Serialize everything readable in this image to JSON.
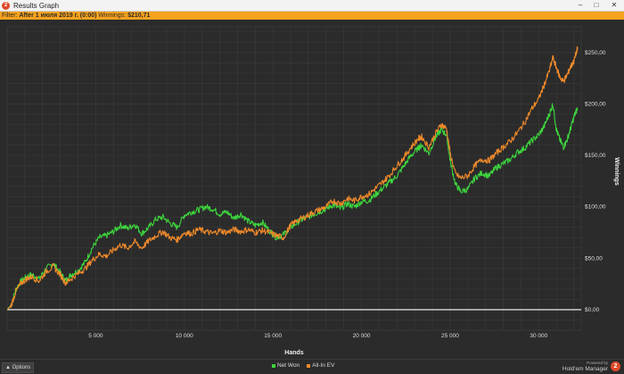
{
  "window": {
    "title": "Results Graph",
    "app_icon_label": "2",
    "minimize": "–",
    "maximize": "□",
    "close": "✕"
  },
  "filter": {
    "label": "Filter:",
    "value": "After 1 июля 2019 г. (0:00)",
    "winnings_label": "Winnings:",
    "winnings_value": "$210,71"
  },
  "footer": {
    "options_label": "Options",
    "options_icon": "triangle-up-icon",
    "brand_small": "Powered by",
    "brand": "Hold'em Manager",
    "brand_logo": "2"
  },
  "colors": {
    "net_won": "#3dd63d",
    "all_in_ev": "#f08a2a",
    "background": "#2b2b2b",
    "grid": "#3b3b3b",
    "zero_line": "#ffffff",
    "filter_bar": "#f6a21e"
  },
  "chart_data": {
    "type": "line",
    "xlabel": "Hands",
    "ylabel": "Winnings",
    "xlim": [
      0,
      32400
    ],
    "ylim": [
      -20,
      275
    ],
    "x_ticks": [
      5000,
      10000,
      15000,
      20000,
      25000,
      30000
    ],
    "x_tick_labels": [
      "5 000",
      "10 000",
      "15 000",
      "20 000",
      "25 000",
      "30 000"
    ],
    "y_ticks": [
      0,
      50,
      100,
      150,
      200,
      250
    ],
    "y_tick_labels": [
      "$0,00",
      "$50,00",
      "$100,00",
      "$150,00",
      "$200,00",
      "$250,00"
    ],
    "legend_position": "bottom-center",
    "grid": true,
    "series": [
      {
        "name": "Net Won",
        "color": "#3dd63d",
        "x": [
          0,
          200,
          500,
          800,
          1100,
          1400,
          1800,
          2200,
          2600,
          3000,
          3300,
          3600,
          4000,
          4400,
          4800,
          5200,
          5600,
          6000,
          6400,
          6800,
          7200,
          7600,
          8000,
          8400,
          8800,
          9200,
          9600,
          10000,
          10400,
          10800,
          11200,
          11600,
          12000,
          12400,
          12800,
          13200,
          13600,
          14000,
          14400,
          14800,
          15200,
          15600,
          16000,
          16400,
          16800,
          17200,
          17600,
          18000,
          18400,
          18800,
          19200,
          19600,
          20000,
          20400,
          20800,
          21200,
          21600,
          22000,
          22400,
          22800,
          23200,
          23400,
          23800,
          24200,
          24500,
          24800,
          25000,
          25300,
          25600,
          26000,
          26400,
          26800,
          27200,
          27600,
          28000,
          28400,
          28800,
          29200,
          29600,
          30000,
          30300,
          30600,
          30800,
          31000,
          31200,
          31400,
          31600,
          31800,
          32000,
          32200
        ],
        "values": [
          0,
          4,
          20,
          28,
          32,
          34,
          30,
          40,
          45,
          36,
          28,
          34,
          38,
          46,
          60,
          70,
          72,
          76,
          82,
          79,
          83,
          74,
          80,
          88,
          90,
          84,
          80,
          92,
          95,
          97,
          100,
          98,
          93,
          95,
          89,
          93,
          86,
          82,
          85,
          77,
          70,
          73,
          80,
          85,
          89,
          92,
          95,
          98,
          102,
          98,
          103,
          100,
          105,
          106,
          112,
          118,
          124,
          130,
          140,
          150,
          157,
          160,
          152,
          168,
          175,
          170,
          145,
          122,
          115,
          117,
          128,
          133,
          130,
          138,
          142,
          146,
          153,
          157,
          164,
          170,
          178,
          190,
          200,
          175,
          165,
          158,
          165,
          176,
          188,
          196
        ]
      },
      {
        "name": "All-In EV",
        "color": "#f08a2a",
        "x": [
          0,
          200,
          500,
          800,
          1100,
          1400,
          1800,
          2200,
          2600,
          3000,
          3300,
          3600,
          4000,
          4400,
          4800,
          5200,
          5600,
          6000,
          6400,
          6800,
          7200,
          7600,
          8000,
          8400,
          8800,
          9200,
          9600,
          10000,
          10400,
          10800,
          11200,
          11600,
          12000,
          12400,
          12800,
          13200,
          13600,
          14000,
          14400,
          14800,
          15200,
          15600,
          16000,
          16400,
          16800,
          17200,
          17600,
          18000,
          18400,
          18800,
          19200,
          19600,
          20000,
          20400,
          20800,
          21200,
          21600,
          22000,
          22400,
          22800,
          23200,
          23400,
          23800,
          24200,
          24500,
          24800,
          25000,
          25300,
          25600,
          26000,
          26400,
          26800,
          27200,
          27600,
          28000,
          28400,
          28800,
          29200,
          29600,
          30000,
          30300,
          30600,
          30800,
          31000,
          31200,
          31400,
          31600,
          31800,
          32000,
          32200
        ],
        "values": [
          0,
          3,
          18,
          26,
          30,
          32,
          28,
          37,
          42,
          34,
          26,
          30,
          35,
          40,
          48,
          54,
          52,
          58,
          63,
          60,
          66,
          60,
          67,
          72,
          76,
          70,
          68,
          75,
          74,
          78,
          76,
          74,
          77,
          75,
          78,
          76,
          78,
          75,
          77,
          75,
          72,
          70,
          82,
          87,
          90,
          94,
          97,
          100,
          106,
          103,
          108,
          106,
          110,
          112,
          118,
          124,
          131,
          140,
          148,
          158,
          166,
          168,
          158,
          172,
          180,
          176,
          152,
          132,
          128,
          130,
          140,
          146,
          145,
          152,
          158,
          164,
          172,
          182,
          195,
          205,
          218,
          232,
          245,
          235,
          226,
          222,
          228,
          236,
          242,
          255
        ]
      }
    ]
  }
}
